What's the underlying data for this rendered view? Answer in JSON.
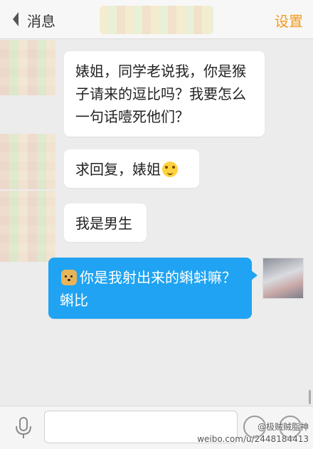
{
  "header": {
    "back_label": "消息",
    "settings_label": "设置"
  },
  "messages": [
    {
      "side": "left",
      "text": "婊姐，同学老说我，你是猴子请来的逗比吗？我要怎么一句话噎死他们？"
    },
    {
      "side": "left",
      "text": "求回复，婊姐",
      "emoji": "blush-icon"
    },
    {
      "side": "left",
      "text": "我是男生"
    },
    {
      "side": "right",
      "text": "你是我射出来的蝌蚪嘛？蝌比",
      "emoji": "doge-icon"
    }
  ],
  "composer": {
    "placeholder": ""
  },
  "watermark": {
    "handle": "@极贼贼脂神",
    "url": "weibo.com/u/2448184413"
  },
  "colors": {
    "accent": "#f39a1e",
    "my_bubble": "#1fa3f2"
  }
}
